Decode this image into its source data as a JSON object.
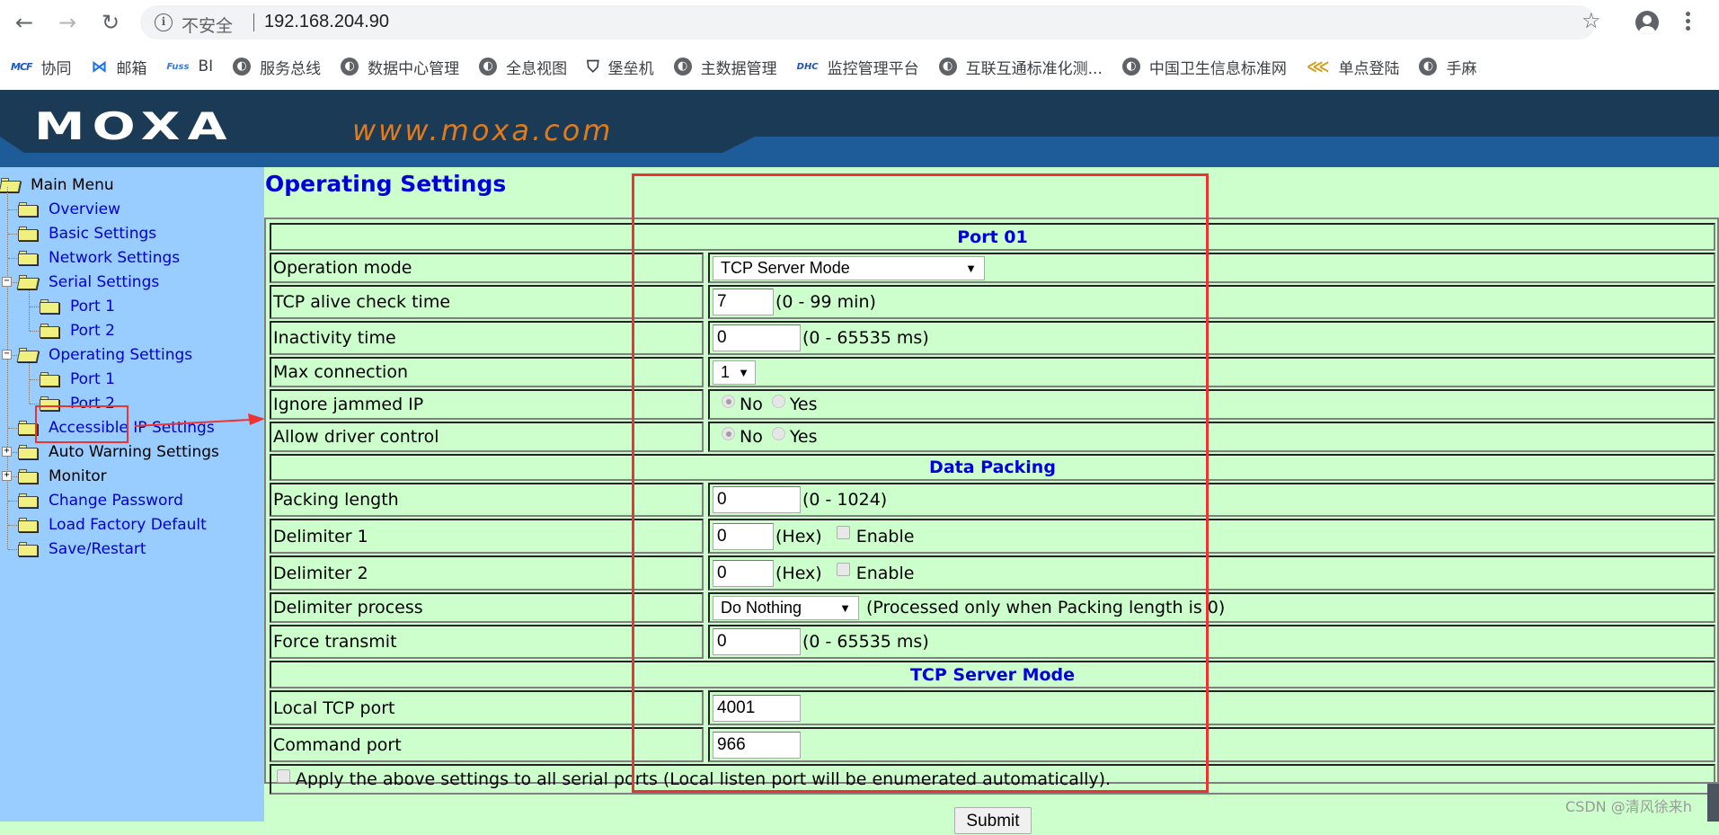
{
  "browser": {
    "security_label": "不安全",
    "url": "192.168.204.90",
    "bookmarks": [
      {
        "icon": "mcf-icon",
        "glyph": "MCF",
        "label": "协同"
      },
      {
        "icon": "mail-icon",
        "glyph": "⋈",
        "label": "邮箱"
      },
      {
        "icon": "bi-icon",
        "glyph": "Fuss",
        "label": "BI"
      },
      {
        "icon": "globe-icon",
        "glyph": "◐",
        "label": "服务总线"
      },
      {
        "icon": "globe-icon",
        "glyph": "◐",
        "label": "数据中心管理"
      },
      {
        "icon": "globe-icon",
        "glyph": "◐",
        "label": "全息视图"
      },
      {
        "icon": "shield-icon",
        "glyph": "⛉",
        "label": "堡垒机"
      },
      {
        "icon": "globe-icon",
        "glyph": "◐",
        "label": "主数据管理"
      },
      {
        "icon": "dhc-icon",
        "glyph": "DHC",
        "label": "监控管理平台"
      },
      {
        "icon": "globe-icon",
        "glyph": "◐",
        "label": "互联互通标准化测..."
      },
      {
        "icon": "globe-icon",
        "glyph": "◐",
        "label": "中国卫生信息标准网"
      },
      {
        "icon": "sso-icon",
        "glyph": "⋘",
        "label": "单点登陆"
      },
      {
        "icon": "globe-icon",
        "glyph": "◐",
        "label": "手麻"
      }
    ]
  },
  "banner": {
    "logo": "MOXA",
    "site": "www.moxa.com"
  },
  "sidebar": {
    "root": "Main Menu",
    "items": [
      {
        "label": "Overview"
      },
      {
        "label": "Basic Settings"
      },
      {
        "label": "Network Settings"
      },
      {
        "label": "Serial Settings",
        "expander": "−"
      },
      {
        "label": "Port 1"
      },
      {
        "label": "Port 2"
      },
      {
        "label": "Operating Settings",
        "expander": "−"
      },
      {
        "label": "Port 1"
      },
      {
        "label": "Port 2"
      },
      {
        "label": "Accessible IP Settings"
      },
      {
        "label": "Auto Warning Settings",
        "expander": "+"
      },
      {
        "label": "Monitor",
        "expander": "+"
      },
      {
        "label": "Change Password"
      },
      {
        "label": "Load Factory Default"
      },
      {
        "label": "Save/Restart"
      }
    ]
  },
  "main": {
    "title": "Operating Settings",
    "port_header": "Port 01",
    "operation_mode": {
      "label": "Operation mode",
      "value": "TCP Server Mode"
    },
    "tcp_alive": {
      "label": "TCP alive check time",
      "value": "7",
      "hint": "(0 - 99 min)"
    },
    "inactivity": {
      "label": "Inactivity time",
      "value": "0",
      "hint": "(0 - 65535 ms)"
    },
    "max_connection": {
      "label": "Max connection",
      "value": "1"
    },
    "ignore_jammed": {
      "label": "Ignore jammed IP",
      "opt_no": "No",
      "opt_yes": "Yes",
      "selected": "No"
    },
    "allow_driver": {
      "label": "Allow driver control",
      "opt_no": "No",
      "opt_yes": "Yes",
      "selected": "No"
    },
    "data_packing_header": "Data Packing",
    "packing_length": {
      "label": "Packing length",
      "value": "0",
      "hint": "(0 - 1024)"
    },
    "delimiter1": {
      "label": "Delimiter 1",
      "value": "0",
      "hint": "(Hex)",
      "enable": "Enable",
      "checked": false
    },
    "delimiter2": {
      "label": "Delimiter 2",
      "value": "0",
      "hint": "(Hex)",
      "enable": "Enable",
      "checked": false
    },
    "delimiter_process": {
      "label": "Delimiter process",
      "value": "Do Nothing",
      "hint": "(Processed only when Packing length is 0)"
    },
    "force_transmit": {
      "label": "Force transmit",
      "value": "0",
      "hint": "(0 - 65535 ms)"
    },
    "tcp_server_header": "TCP Server Mode",
    "local_tcp_port": {
      "label": "Local TCP port",
      "value": "4001"
    },
    "command_port": {
      "label": "Command port",
      "value": "966"
    },
    "apply_all": {
      "label": "Apply the above settings to all serial ports (Local listen port will be enumerated automatically).",
      "checked": false
    },
    "submit": "Submit"
  },
  "watermark": "CSDN @清风徐来h"
}
